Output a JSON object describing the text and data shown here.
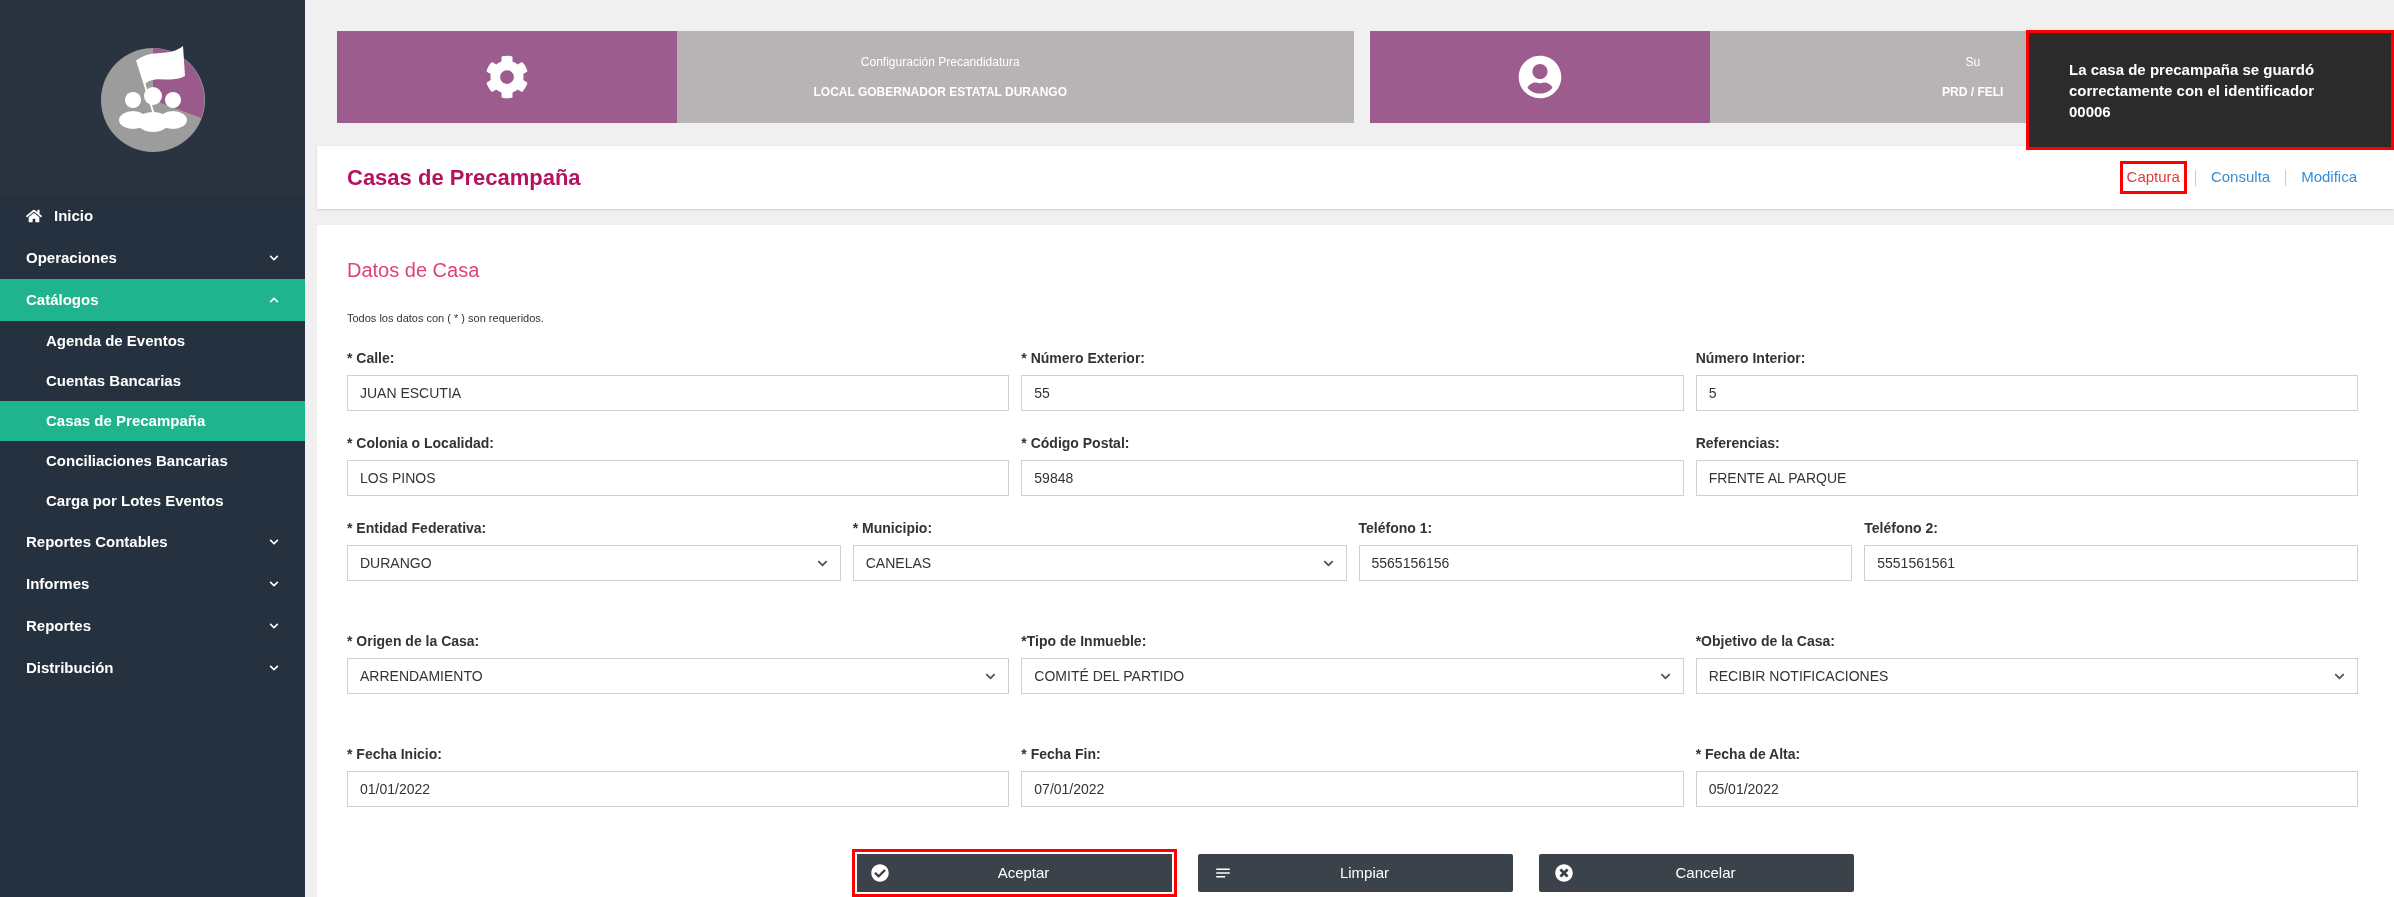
{
  "sidebar": {
    "items": [
      {
        "kind": "link",
        "label": "Inicio",
        "selected": false
      },
      {
        "kind": "group",
        "label": "Operaciones",
        "selected": false,
        "expanded": false
      },
      {
        "kind": "group",
        "label": "Catálogos",
        "selected": true,
        "expanded": true,
        "children": [
          {
            "label": "Agenda de Eventos",
            "selected": false
          },
          {
            "label": "Cuentas Bancarias",
            "selected": false
          },
          {
            "label": "Casas de Precampaña",
            "selected": true
          },
          {
            "label": "Conciliaciones Bancarias",
            "selected": false
          },
          {
            "label": "Carga por Lotes Eventos",
            "selected": false
          }
        ]
      },
      {
        "kind": "group",
        "label": "Reportes Contables",
        "selected": false,
        "expanded": false
      },
      {
        "kind": "group",
        "label": "Informes",
        "selected": false,
        "expanded": false
      },
      {
        "kind": "group",
        "label": "Reportes",
        "selected": false,
        "expanded": false
      },
      {
        "kind": "group",
        "label": "Distribución",
        "selected": false,
        "expanded": false
      }
    ]
  },
  "banner": [
    {
      "kind": "settings",
      "title": "Configuración Precandidatura",
      "subtitle": "LOCAL GOBERNADOR ESTATAL DURANGO"
    },
    {
      "kind": "user",
      "title": "Su",
      "subtitle": "PRD / FELI"
    }
  ],
  "toast": {
    "message": "La casa de precampaña se guardó correctamente con el identificador 00006",
    "highlighted": true
  },
  "page": {
    "title": "Casas de Precampaña"
  },
  "tabs": [
    {
      "label": "Captura",
      "selected": true,
      "highlighted": true
    },
    {
      "label": "Consulta",
      "selected": false,
      "highlighted": false
    },
    {
      "label": "Modifica",
      "selected": false,
      "highlighted": false
    }
  ],
  "form": {
    "title": "Datos de Casa",
    "note": "Todos los datos con ( * ) son requeridos.",
    "rows": [
      [
        {
          "kind": "text",
          "label": "* Calle:",
          "value": "JUAN ESCUTIA"
        },
        {
          "kind": "text",
          "label": "* Número Exterior:",
          "value": "55"
        },
        {
          "kind": "text",
          "label": "Número Interior:",
          "value": "5"
        }
      ],
      [
        {
          "kind": "text",
          "label": "* Colonia o Localidad:",
          "value": "LOS PINOS"
        },
        {
          "kind": "text",
          "label": "* Código Postal:",
          "value": "59848"
        },
        {
          "kind": "text",
          "label": "Referencias:",
          "value": "FRENTE AL PARQUE"
        }
      ],
      [
        {
          "kind": "select",
          "label": "* Entidad Federativa:",
          "value": "DURANGO"
        },
        {
          "kind": "select",
          "label": "* Municipio:",
          "value": "CANELAS"
        },
        {
          "kind": "text",
          "label": "Teléfono 1:",
          "value": "5565156156"
        },
        {
          "kind": "text",
          "label": "Teléfono 2:",
          "value": "5551561561"
        }
      ],
      [
        {
          "kind": "select",
          "label": "* Origen de la Casa:",
          "value": "ARRENDAMIENTO"
        },
        {
          "kind": "select",
          "label": "*Tipo de Inmueble:",
          "value": "COMITÉ DEL PARTIDO"
        },
        {
          "kind": "select",
          "label": "*Objetivo de la Casa:",
          "value": "RECIBIR NOTIFICACIONES"
        }
      ],
      [
        {
          "kind": "text",
          "label": "* Fecha Inicio:",
          "value": "01/01/2022"
        },
        {
          "kind": "text",
          "label": "* Fecha Fin:",
          "value": "07/01/2022"
        },
        {
          "kind": "text",
          "label": "* Fecha de Alta:",
          "value": "05/01/2022"
        }
      ]
    ]
  },
  "buttons": [
    {
      "kind": "accept",
      "label": "Aceptar",
      "highlighted": true
    },
    {
      "kind": "clear",
      "label": "Limpiar",
      "highlighted": false
    },
    {
      "kind": "cancel",
      "label": "Cancelar",
      "highlighted": false
    }
  ]
}
